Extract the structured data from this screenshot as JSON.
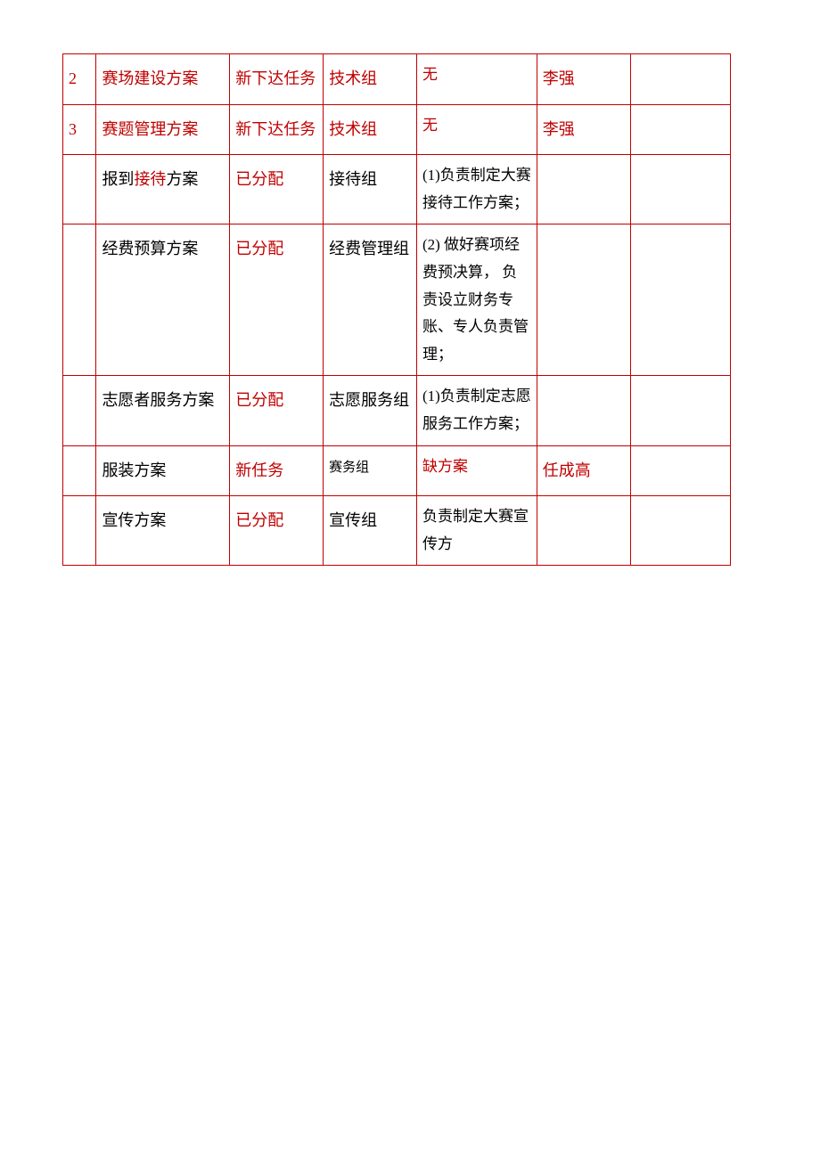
{
  "rows": [
    {
      "num": "2",
      "num_red": true,
      "name": "赛场建设方案",
      "name_red": true,
      "status": "新下达任务",
      "status_red": true,
      "group": "技术组",
      "group_red": true,
      "desc": "无",
      "desc_red": true,
      "person": "李强",
      "person_red": true
    },
    {
      "num": "3",
      "num_red": true,
      "name": "赛题管理方案",
      "name_red": true,
      "status": "新下达任务",
      "status_red": true,
      "group": "技术组",
      "group_red": true,
      "desc": "无",
      "desc_red": true,
      "person": "李强",
      "person_red": true
    },
    {
      "num": "",
      "name": "报到接待方案",
      "name_red": false,
      "name_partial_red": "接待",
      "status": "已分配",
      "status_red": true,
      "group": "接待组",
      "group_red": false,
      "desc": "  (1)负责制定大赛接待工作方案；",
      "desc_red": false,
      "person": ""
    },
    {
      "num": "",
      "name": "经费预算方案",
      "name_red": false,
      "status": "已分配",
      "status_red": true,
      "group": "经费管理组",
      "group_red": false,
      "desc": "        (2) 做好赛项经费预决算， 负责设立财务专账、专人负责管理；",
      "desc_red": false,
      "person": ""
    },
    {
      "num": "",
      "name": "志愿者服务方案",
      "name_red": false,
      "status": "已分配",
      "status_red": true,
      "group": "志愿服务组",
      "group_red": false,
      "desc": "  (1)负责制定志愿服务工作方案；",
      "desc_red": false,
      "person": ""
    },
    {
      "num": "",
      "name": "服装方案",
      "name_red": false,
      "status": "新任务",
      "status_red": true,
      "group": "赛务组",
      "group_red": false,
      "group_small": true,
      "desc": "缺方案",
      "desc_red": true,
      "person": "任成高",
      "person_red": true
    },
    {
      "num": "",
      "name": "宣传方案",
      "name_red": false,
      "status": "已分配",
      "status_red": true,
      "group": "宣传组",
      "group_red": false,
      "desc": "负责制定大赛宣传方",
      "desc_red": false,
      "person": ""
    }
  ]
}
